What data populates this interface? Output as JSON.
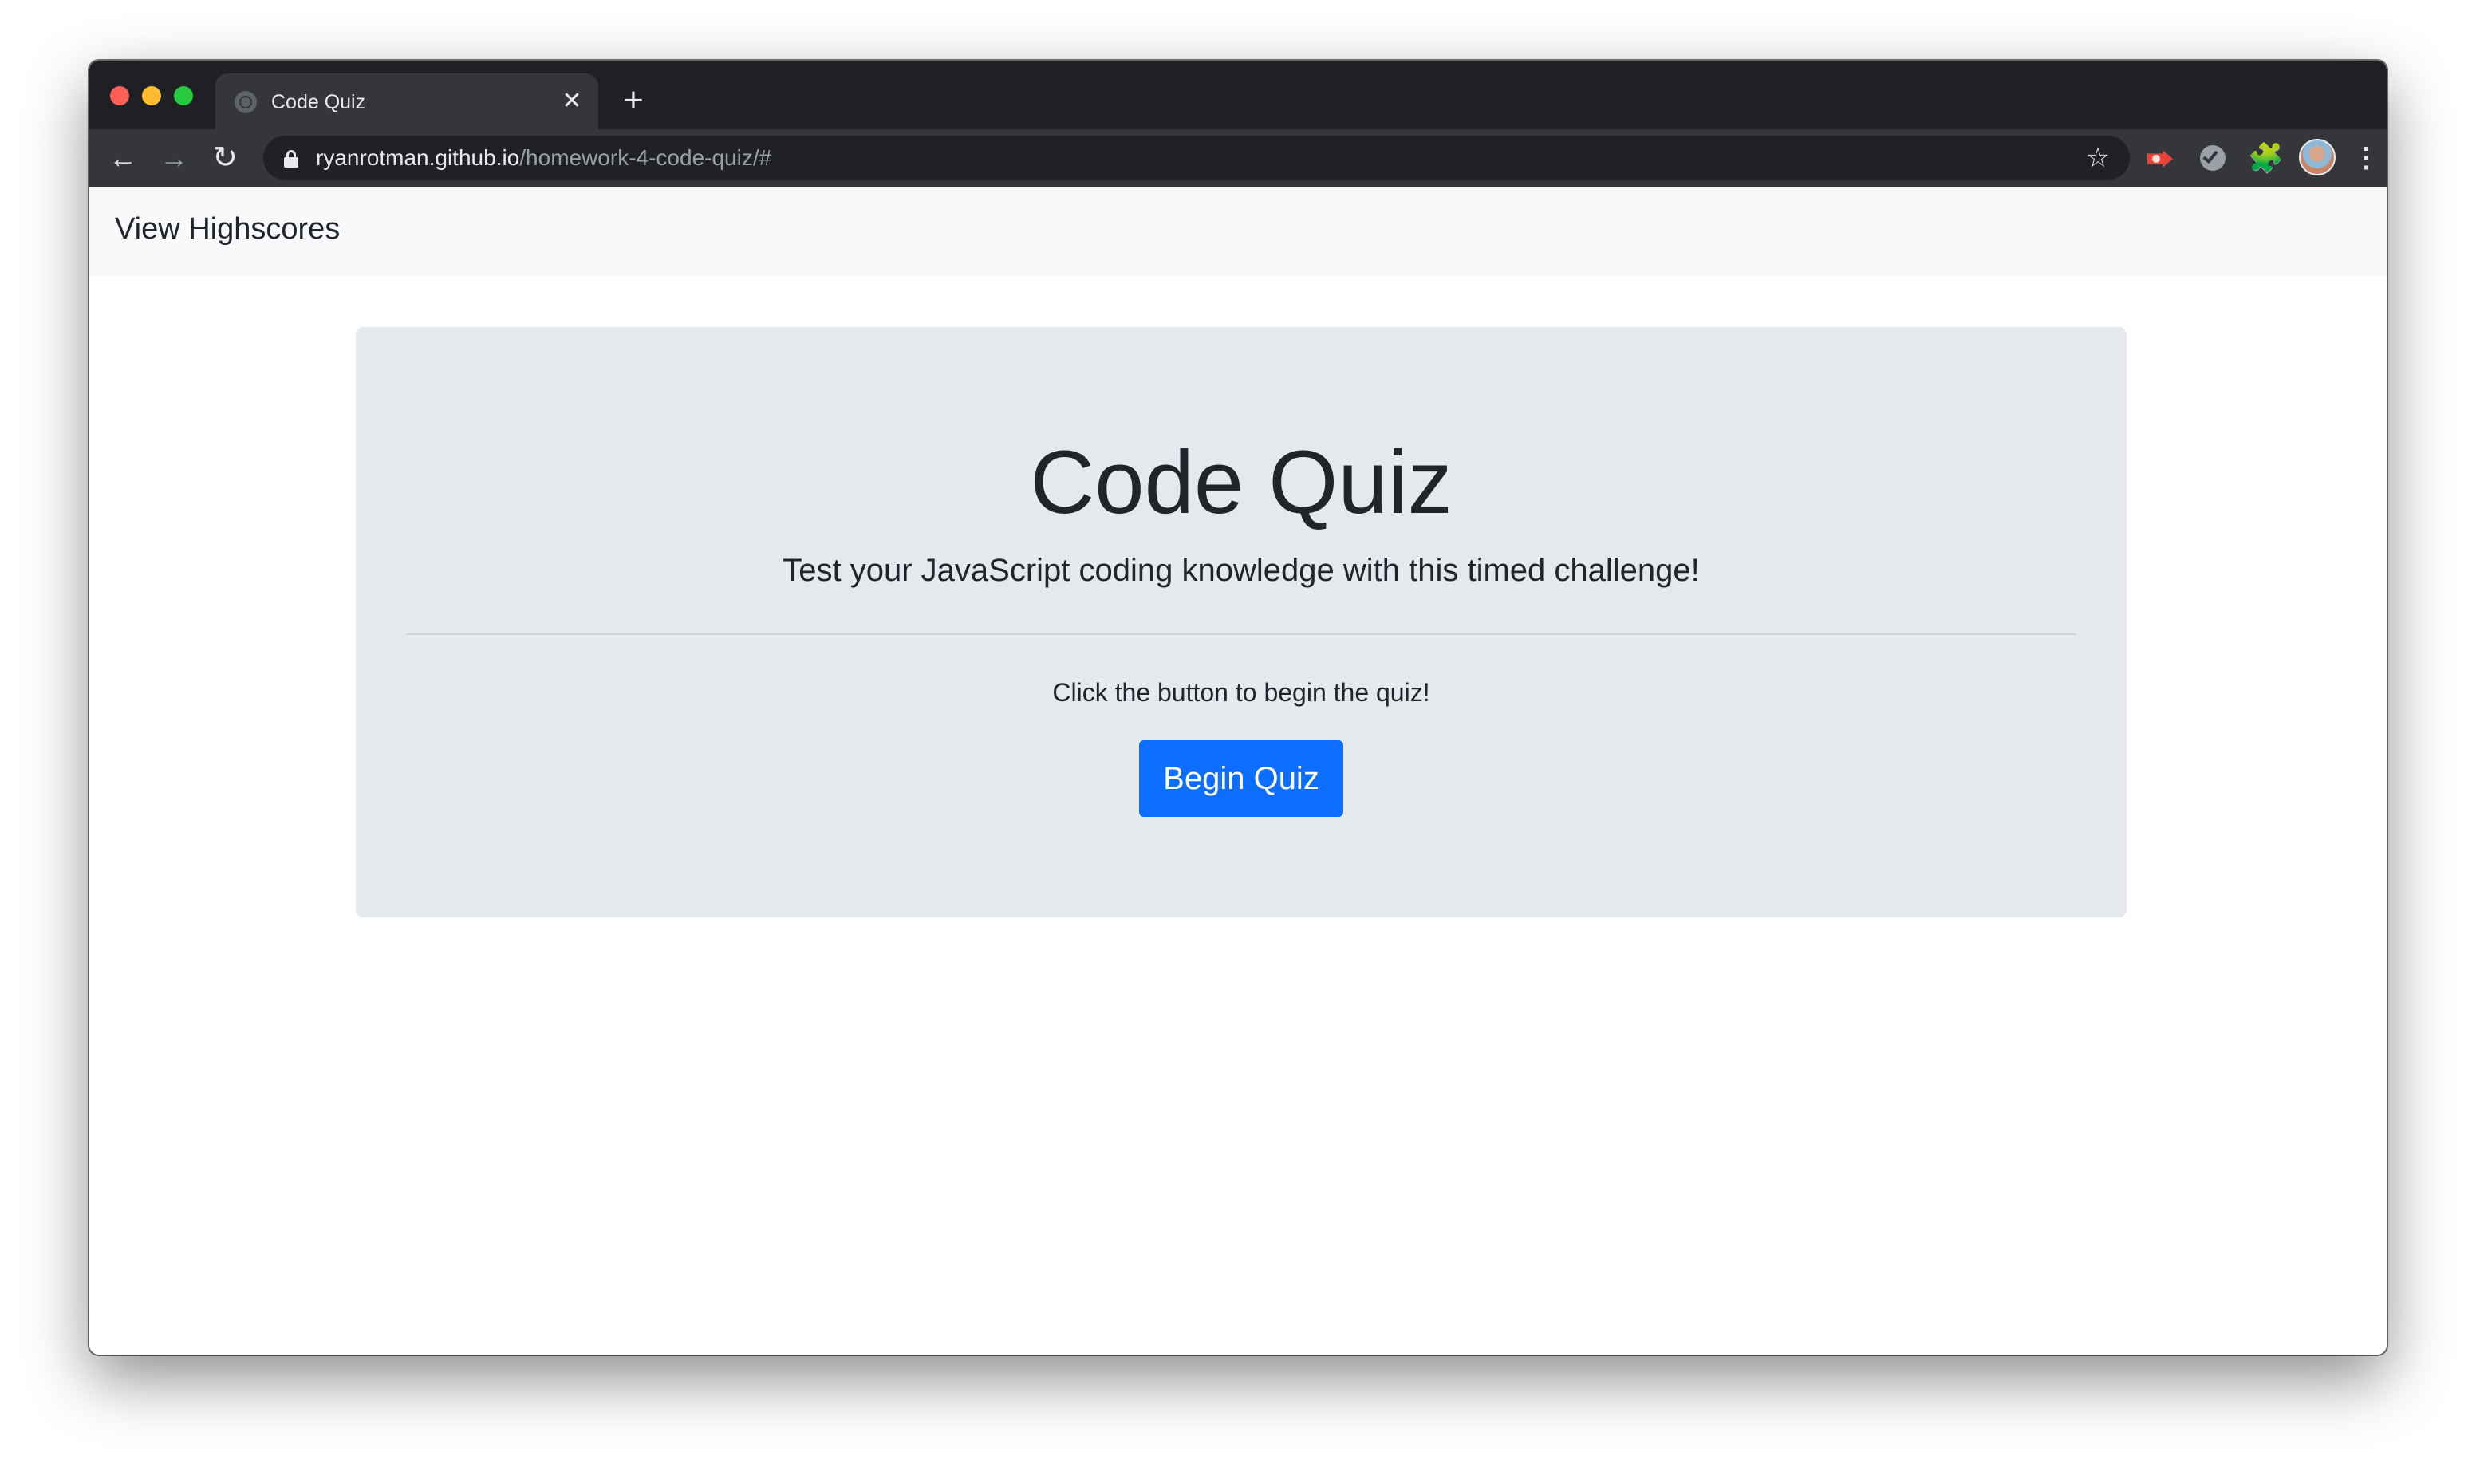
{
  "browser": {
    "tab": {
      "title": "Code Quiz",
      "close_glyph": "✕",
      "favicon": "globe-icon"
    },
    "new_tab_glyph": "+",
    "nav": {
      "back_glyph": "←",
      "forward_glyph": "→",
      "reload_glyph": "↻"
    },
    "address": {
      "host": "ryanrotman.github.io",
      "path": "/homework-4-code-quiz/#"
    },
    "bookmark_glyph": "☆",
    "extensions_glyph": "🧩",
    "menu_glyph": "⋮"
  },
  "navbar": {
    "highscores_label": "View Highscores"
  },
  "jumbotron": {
    "title": "Code Quiz",
    "lead": "Test your JavaScript coding knowledge with this timed challenge!",
    "instruction": "Click the button to begin the quiz!",
    "button_label": "Begin Quiz"
  },
  "colors": {
    "primary_button": "#0d6efd",
    "jumbotron_bg": "#e5e8ed",
    "navbar_bg": "#f8f9fa",
    "browser_frame": "#1f2023"
  }
}
